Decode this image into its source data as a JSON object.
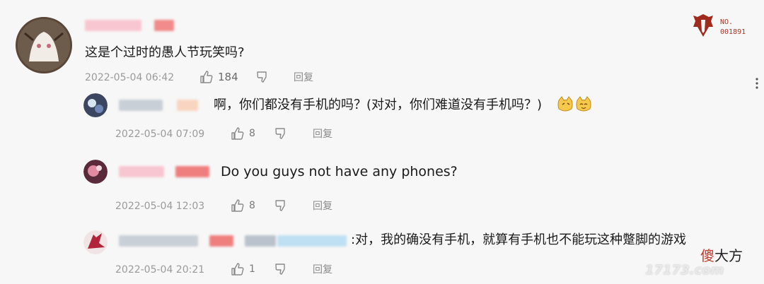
{
  "post": {
    "text": "这是个过时的愚人节玩笑吗?",
    "time": "2022-05-04 06:42",
    "likes": "184",
    "reply_label": "回复"
  },
  "badge": {
    "line1": "NO.",
    "line2": "001891"
  },
  "comments": [
    {
      "text": "啊，你们都没有手机的吗？(对对，你们难道没有手机吗？)",
      "time": "2022-05-04 07:09",
      "likes": "8",
      "reply_label": "回复"
    },
    {
      "text": "Do you guys not have any phones?",
      "time": "2022-05-04 12:03",
      "likes": "8",
      "reply_label": "回复"
    },
    {
      "text": ":对，我的确没有手机，就算有手机也不能玩这种蹩脚的游戏",
      "time": "2022-05-04 20:21",
      "likes": "1",
      "reply_label": "回复"
    }
  ],
  "watermark": {
    "brand": "傻大方",
    "site": "17173.com"
  },
  "colors": {
    "accent_red": "#c0392b",
    "blur_pink": "#f4b3bf",
    "blur_red": "#ef7f7f"
  }
}
